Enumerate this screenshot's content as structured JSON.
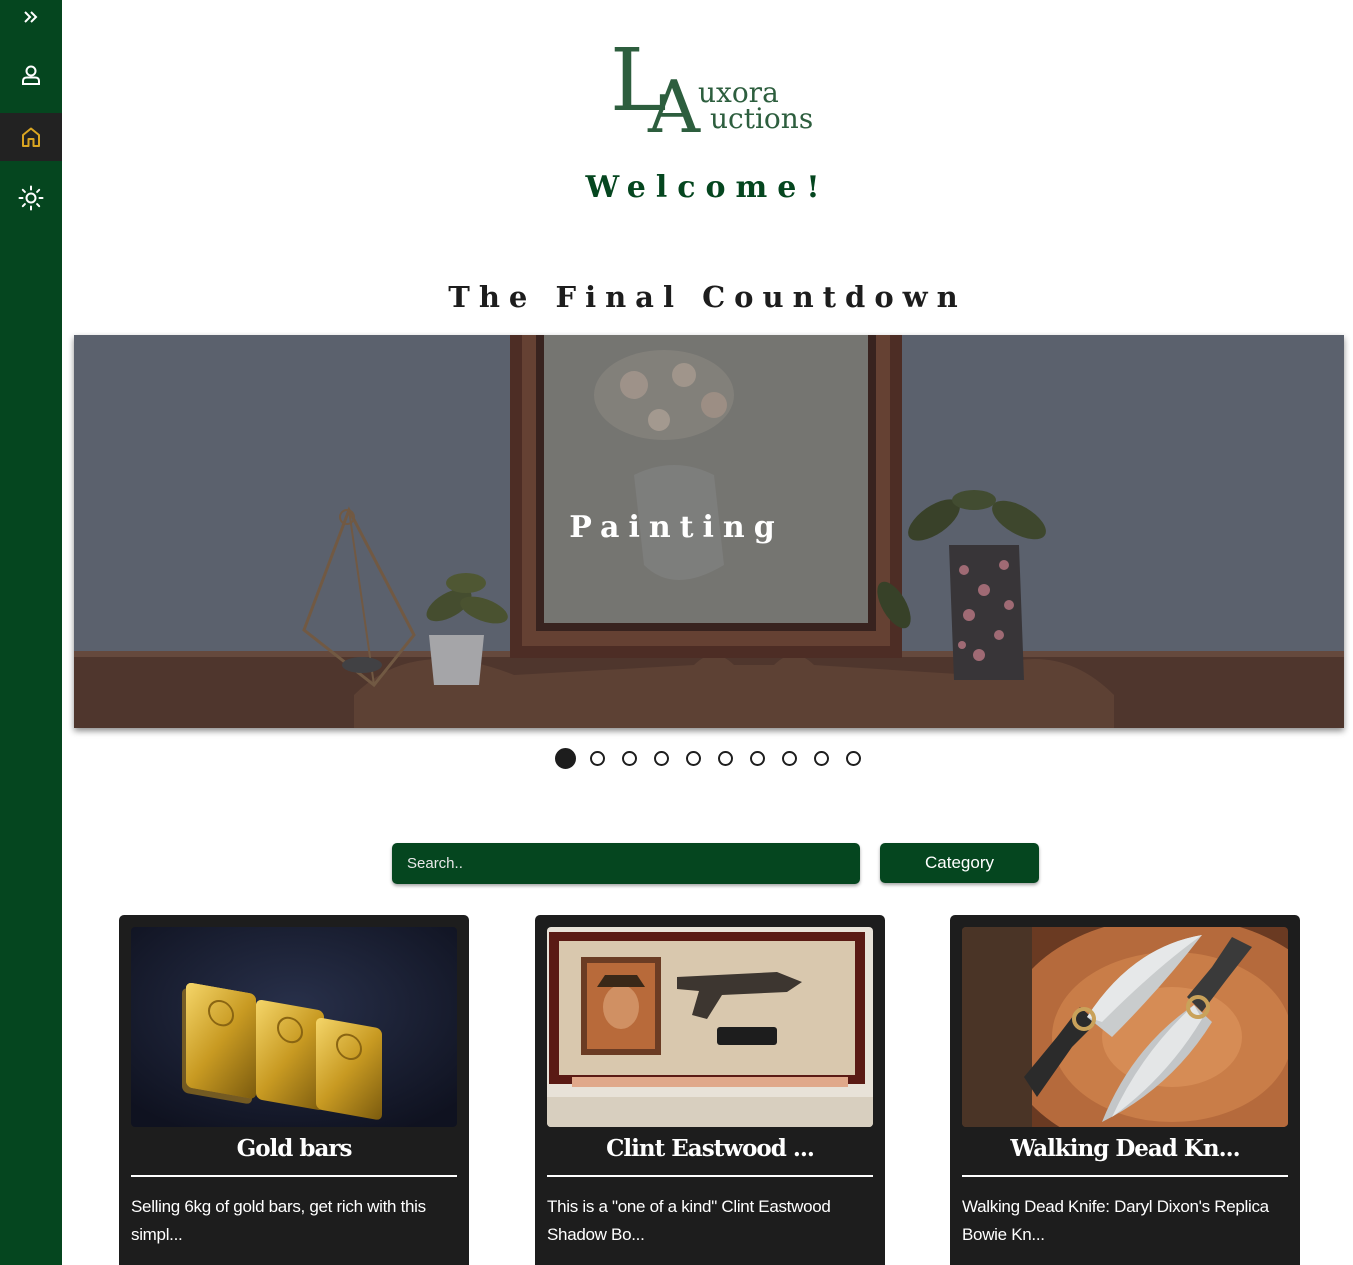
{
  "sidebar": {
    "items": [
      {
        "icon": "expand-icon"
      },
      {
        "icon": "user-icon"
      },
      {
        "icon": "home-icon",
        "active": true
      },
      {
        "icon": "sun-icon"
      }
    ]
  },
  "logo": {
    "letter_l": "L",
    "letter_a": "A",
    "line1": "uxora",
    "line2": "uctions"
  },
  "welcome": "Welcome!",
  "section_title": "The Final Countdown",
  "carousel": {
    "caption": "Painting",
    "slide_count": 10,
    "active_index": 0
  },
  "search": {
    "placeholder": "Search.."
  },
  "category_label": "Category",
  "cards": [
    {
      "title": "Gold bars",
      "description": "Selling 6kg of gold bars, get rich with this simpl..."
    },
    {
      "title": "Clint Eastwood ...",
      "description": "This is a \"one of a kind\" Clint Eastwood Shadow Bo..."
    },
    {
      "title": "Walking Dead Kn...",
      "description": "Walking Dead Knife: Daryl Dixon's Replica Bowie Kn..."
    }
  ],
  "colors": {
    "brand_green": "#05461f",
    "dark": "#1d1d1d",
    "accent_gold": "#d9a521"
  }
}
